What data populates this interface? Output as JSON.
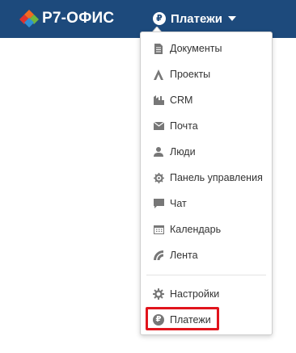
{
  "header": {
    "brand": "Р7-ОФИС",
    "module_label": "Платежи",
    "module_icon": "ruble-icon",
    "module_icon_glyph": "₽",
    "background_color": "#1d4a7c"
  },
  "menu": {
    "items": [
      {
        "label": "Документы",
        "icon": "documents-icon"
      },
      {
        "label": "Проекты",
        "icon": "projects-icon"
      },
      {
        "label": "CRM",
        "icon": "crm-icon"
      },
      {
        "label": "Почта",
        "icon": "mail-icon"
      },
      {
        "label": "Люди",
        "icon": "people-icon"
      },
      {
        "label": "Панель управления",
        "icon": "control-panel-icon"
      },
      {
        "label": "Чат",
        "icon": "chat-icon"
      },
      {
        "label": "Календарь",
        "icon": "calendar-icon"
      },
      {
        "label": "Лента",
        "icon": "feed-icon"
      }
    ],
    "footer_items": [
      {
        "label": "Настройки",
        "icon": "settings-icon"
      },
      {
        "label": "Платежи",
        "icon": "ruble-icon",
        "glyph": "₽",
        "highlighted": true
      }
    ],
    "highlight_color": "#e1141c"
  }
}
